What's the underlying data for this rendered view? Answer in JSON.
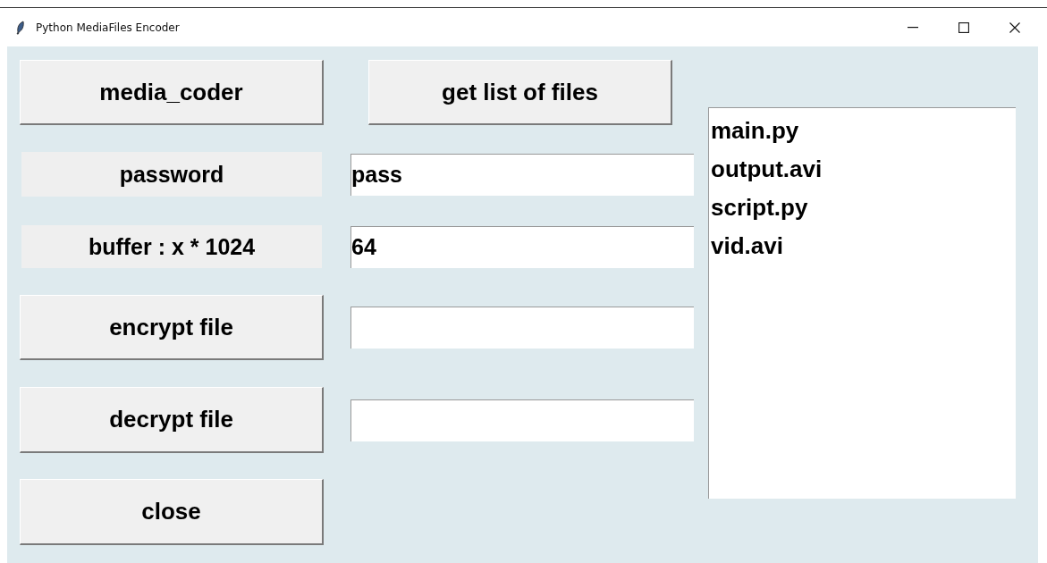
{
  "window": {
    "title": "Python MediaFiles Encoder"
  },
  "top_buttons": [
    {
      "label": "media_coder"
    },
    {
      "label": "get list of files"
    }
  ],
  "settings": [
    {
      "label": "password",
      "value": "pass"
    },
    {
      "label": "buffer : x * 1024",
      "value": "64"
    }
  ],
  "actions": [
    {
      "label": "encrypt file",
      "kind": "with-field"
    },
    {
      "label": "decrypt file",
      "kind": "with-field"
    },
    {
      "label": "close",
      "kind": "plain"
    }
  ],
  "files": [
    "main.py",
    "output.avi",
    "script.py",
    "vid.avi"
  ]
}
